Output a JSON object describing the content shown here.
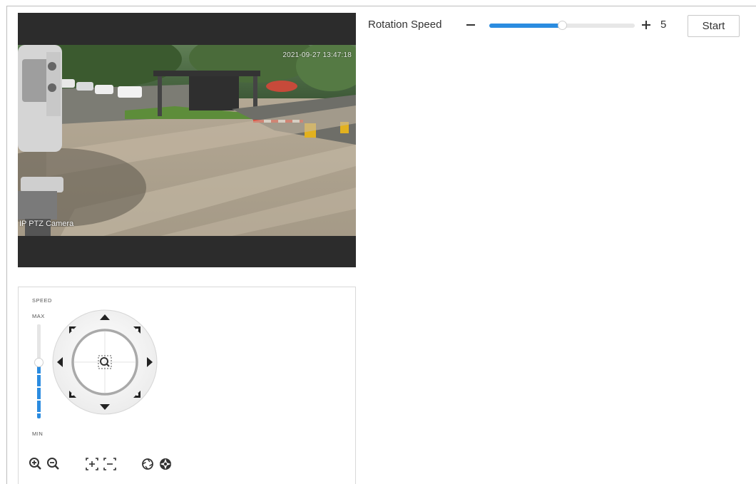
{
  "video": {
    "timestamp": "2021-09-27 13:47:18",
    "camera_name": "IP PTZ Camera"
  },
  "rotation": {
    "label": "Rotation Speed",
    "value": "5",
    "level": 0.5,
    "start_label": "Start"
  },
  "ptz": {
    "speed_label": "SPEED",
    "max_label": "MAX",
    "min_label": "MIN",
    "speed_level": 0.6
  },
  "colors": {
    "accent": "#2b8ce0",
    "video_bg": "#2c2c2c"
  },
  "icons": {
    "zoom_in": "zoom-in-icon",
    "zoom_out": "zoom-out-icon",
    "focus_near": "focus-near-icon",
    "focus_far": "focus-far-icon",
    "iris_open": "iris-open-icon",
    "iris_close": "iris-close-icon",
    "center": "magnifier-center-icon"
  }
}
